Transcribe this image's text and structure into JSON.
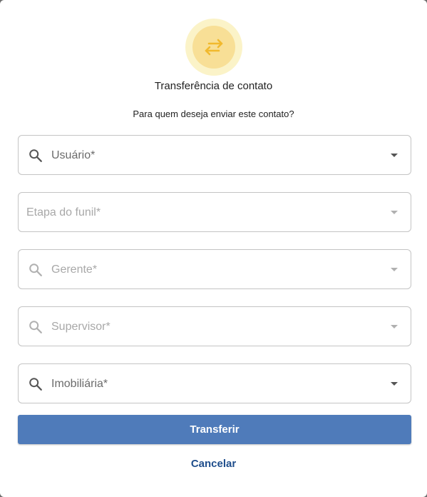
{
  "dialog": {
    "title": "Transferência de contato",
    "question": "Para quem deseja enviar este contato?",
    "badge_icon": "swap-arrows-icon",
    "accent_color": "#f1b92e"
  },
  "fields": {
    "usuario": {
      "placeholder": "Usuário*",
      "state": "enabled"
    },
    "etapa_funil": {
      "placeholder": "Etapa do funil*",
      "state": "disabled"
    },
    "gerente": {
      "placeholder": "Gerente*",
      "state": "disabled"
    },
    "supervisor": {
      "placeholder": "Supervisor*",
      "state": "disabled"
    },
    "imobiliaria": {
      "placeholder": "Imobiliária*",
      "state": "enabled"
    }
  },
  "actions": {
    "submit_label": "Transferir",
    "submit_color": "#4f7bba",
    "cancel_label": "Cancelar"
  }
}
